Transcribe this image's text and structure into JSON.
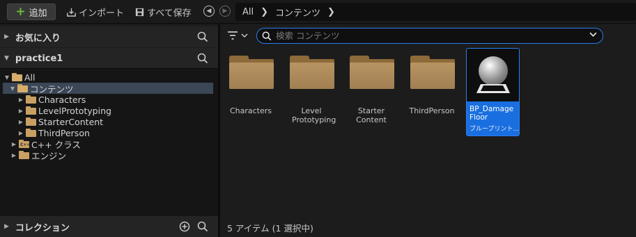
{
  "toolbar": {
    "add_label": "追加",
    "import_label": "インポート",
    "save_all_label": "すべて保存"
  },
  "breadcrumb": [
    "All",
    "コンテンツ"
  ],
  "favorites": {
    "title": "お気に入り"
  },
  "project": {
    "title": "practice1"
  },
  "tree": {
    "items": [
      {
        "label": "All"
      },
      {
        "label": "コンテンツ"
      },
      {
        "label": "Characters"
      },
      {
        "label": "LevelPrototyping"
      },
      {
        "label": "StarterContent"
      },
      {
        "label": "ThirdPerson"
      },
      {
        "label": "C++ クラス"
      },
      {
        "label": "エンジン"
      }
    ]
  },
  "collections": {
    "title": "コレクション"
  },
  "search": {
    "placeholder": "検索 コンテンツ",
    "value": ""
  },
  "assets": [
    {
      "label": "Characters"
    },
    {
      "label": "Level Prototyping"
    },
    {
      "label": "Starter Content"
    },
    {
      "label": "ThirdPerson"
    }
  ],
  "selected_asset": {
    "name": "BP_Damage Floor",
    "type": "ブループリント..."
  },
  "status": "5 アイテム (1 選択中)",
  "colors": {
    "accent": "#2a7ef0",
    "selection": "#1a6fe0",
    "folder": "#c9a063",
    "add_icon": "#6bbd3b"
  }
}
